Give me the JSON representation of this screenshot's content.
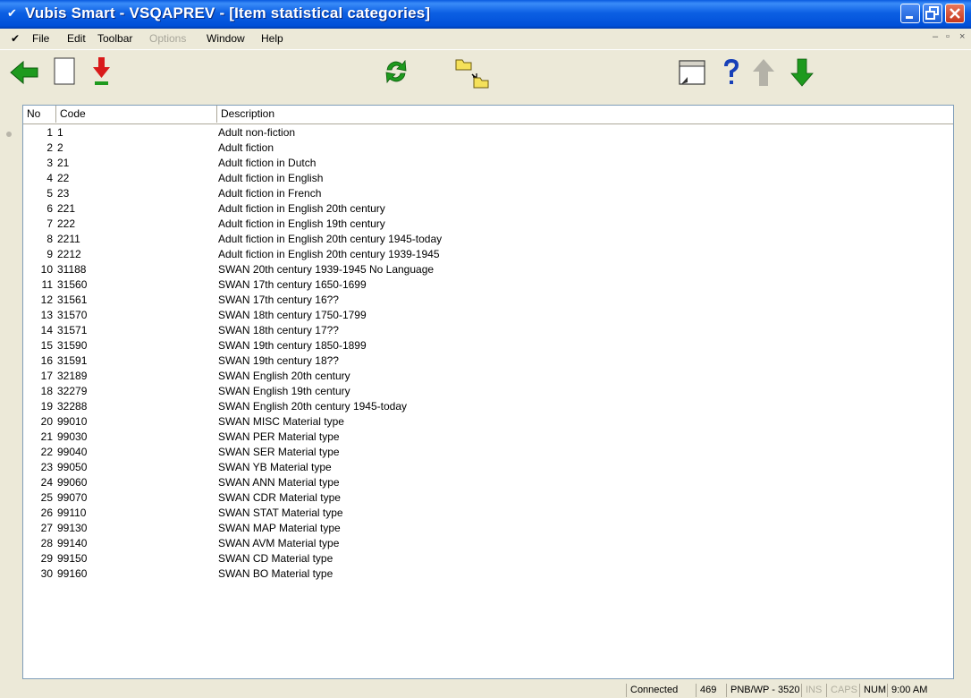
{
  "window": {
    "title": "Vubis Smart - VSQAPREV - [Item statistical categories]"
  },
  "menu": {
    "items": [
      {
        "label": "File",
        "disabled": false
      },
      {
        "label": "Edit",
        "disabled": false
      },
      {
        "label": "Toolbar",
        "disabled": false
      },
      {
        "label": "Options",
        "disabled": true
      },
      {
        "label": "Window",
        "disabled": false
      },
      {
        "label": "Help",
        "disabled": false
      }
    ]
  },
  "toolbar": {
    "icons": [
      "back-arrow-icon",
      "new-document-icon",
      "download-red-arrow-icon",
      "refresh-icon",
      "folder-move-icon",
      "window-icon",
      "help-icon",
      "up-arrow-icon",
      "down-arrow-icon"
    ]
  },
  "list": {
    "columns": [
      "No",
      "Code",
      "Description"
    ],
    "rows": [
      {
        "no": "1",
        "code": "1",
        "desc": "Adult non-fiction"
      },
      {
        "no": "2",
        "code": "2",
        "desc": "Adult fiction"
      },
      {
        "no": "3",
        "code": "21",
        "desc": "Adult fiction in Dutch"
      },
      {
        "no": "4",
        "code": "22",
        "desc": "Adult fiction in English"
      },
      {
        "no": "5",
        "code": "23",
        "desc": "Adult fiction in French"
      },
      {
        "no": "6",
        "code": "221",
        "desc": "Adult fiction in English 20th century"
      },
      {
        "no": "7",
        "code": "222",
        "desc": "Adult fiction in English 19th century"
      },
      {
        "no": "8",
        "code": "2211",
        "desc": "Adult fiction in English 20th century 1945-today"
      },
      {
        "no": "9",
        "code": "2212",
        "desc": "Adult fiction in English 20th century 1939-1945"
      },
      {
        "no": "10",
        "code": "31188",
        "desc": "SWAN 20th century 1939-1945  No Language"
      },
      {
        "no": "11",
        "code": "31560",
        "desc": "SWAN 17th century 1650-1699"
      },
      {
        "no": "12",
        "code": "31561",
        "desc": "SWAN 17th century 16??"
      },
      {
        "no": "13",
        "code": "31570",
        "desc": "SWAN 18th century 1750-1799"
      },
      {
        "no": "14",
        "code": "31571",
        "desc": "SWAN 18th century 17??"
      },
      {
        "no": "15",
        "code": "31590",
        "desc": "SWAN 19th century 1850-1899"
      },
      {
        "no": "16",
        "code": "31591",
        "desc": "SWAN 19th century 18??"
      },
      {
        "no": "17",
        "code": "32189",
        "desc": "SWAN English 20th century"
      },
      {
        "no": "18",
        "code": "32279",
        "desc": "SWAN English 19th century"
      },
      {
        "no": "19",
        "code": "32288",
        "desc": "SWAN English 20th century 1945-today"
      },
      {
        "no": "20",
        "code": "99010",
        "desc": "SWAN MISC Material type"
      },
      {
        "no": "21",
        "code": "99030",
        "desc": "SWAN PER Material type"
      },
      {
        "no": "22",
        "code": "99040",
        "desc": "SWAN SER Material type"
      },
      {
        "no": "23",
        "code": "99050",
        "desc": "SWAN YB Material type"
      },
      {
        "no": "24",
        "code": "99060",
        "desc": "SWAN ANN Material type"
      },
      {
        "no": "25",
        "code": "99070",
        "desc": "SWAN CDR Material type"
      },
      {
        "no": "26",
        "code": "99110",
        "desc": "SWAN STAT Material type"
      },
      {
        "no": "27",
        "code": "99130",
        "desc": "SWAN MAP Material type"
      },
      {
        "no": "28",
        "code": "99140",
        "desc": "SWAN AVM Material type"
      },
      {
        "no": "29",
        "code": "99150",
        "desc": "SWAN CD Material type"
      },
      {
        "no": "30",
        "code": "99160",
        "desc": "SWAN BO Material type"
      }
    ]
  },
  "status": {
    "connection": "Connected",
    "count": "469",
    "session": "PNB/WP - 3520",
    "ins": "INS",
    "caps": "CAPS",
    "num": "NUM",
    "time": "9:00 AM"
  },
  "colors": {
    "title_bar": "#0c5fe3",
    "green_arrow": "#1e9a1e",
    "red_arrow": "#d91a1a",
    "help": "#1740b8"
  }
}
